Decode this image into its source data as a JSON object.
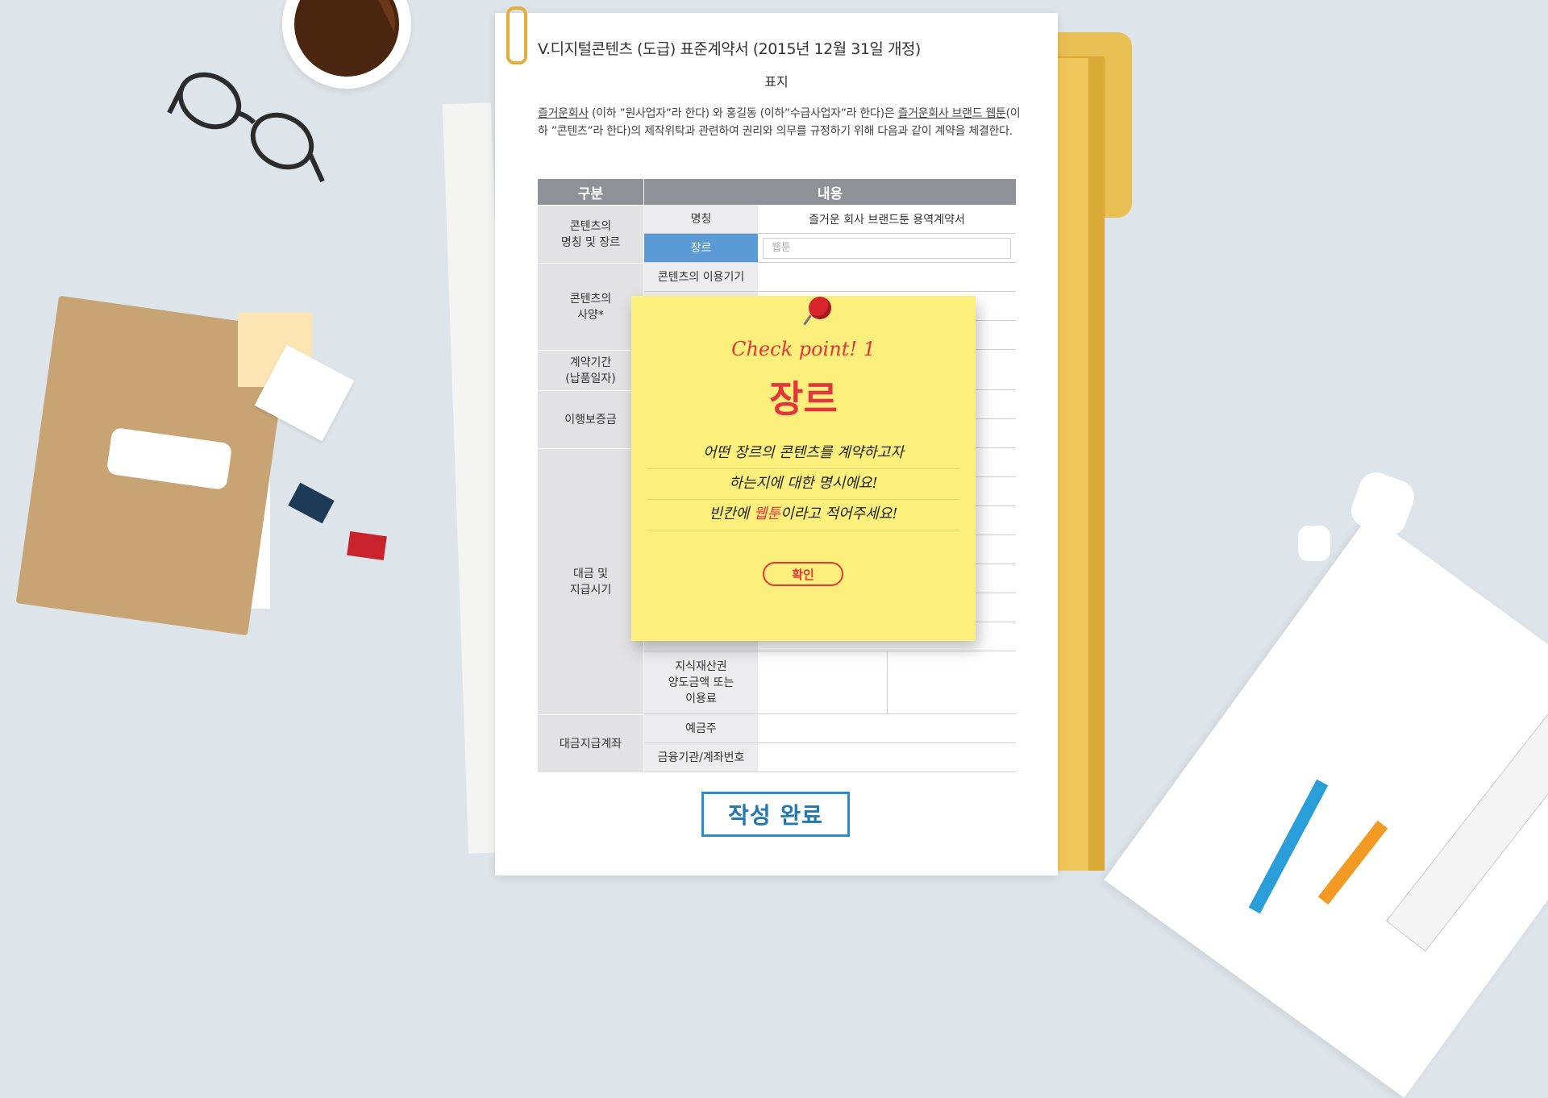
{
  "document": {
    "title": "V.디지털콘텐츠 (도급) 표준계약서 (2015년 12월 31일 개정)",
    "subtitle": "표지",
    "intro": {
      "company": "즐거운회사",
      "part1": " (이하 ”원사업자”라 한다) 와 홍길동 (이하”수급사업자”라 한다)은 ",
      "brand": "즐거운회사 브랜드 웹툰",
      "part2": "(이하 ”콘텐츠”라 한다)의 제작위탁과 관련하여 권리와 의무를 규정하기 위해 다음과 같이 계약을 체결한다."
    },
    "table": {
      "header_category": "구분",
      "header_content": "내용",
      "groups": {
        "name_genre": "콘텐츠의\n명칭 및 장르",
        "spec": "콘텐츠의\n사양*",
        "period": "계약기간\n(납품일자)",
        "guarantee": "이행보증금",
        "payment": "대금 및\n지급시기",
        "account": "대금지급계좌"
      },
      "rows": {
        "name_label": "명칭",
        "name_value": "즐거운 회사 브랜드툰 용역계약서",
        "genre_label": "장르",
        "genre_placeholder": "웹툰",
        "device_label": "콘텐츠의 이용기기",
        "ip_label": "지식재산권\n양도금액 또는\n이용료",
        "holder_label": "예금주",
        "bank_label": "금융기관/계좌번호"
      }
    },
    "submit_label": "작성 완료"
  },
  "popup": {
    "heading": "Check point! 1",
    "title": "장르",
    "lines": [
      "어떤 장르의 콘텐츠를 계약하고자",
      "하는지에 대한 명시에요!"
    ],
    "line3_pre": "빈칸에 ",
    "line3_highlight": "웹툰",
    "line3_post": "이라고 적어주세요!",
    "confirm_label": "확인"
  },
  "colors": {
    "table_header": "#8e9197",
    "active_cell": "#5b9bd5",
    "note": "#fdef7b",
    "accent_red": "#e2363e",
    "submit_blue": "#2a8ccf"
  }
}
